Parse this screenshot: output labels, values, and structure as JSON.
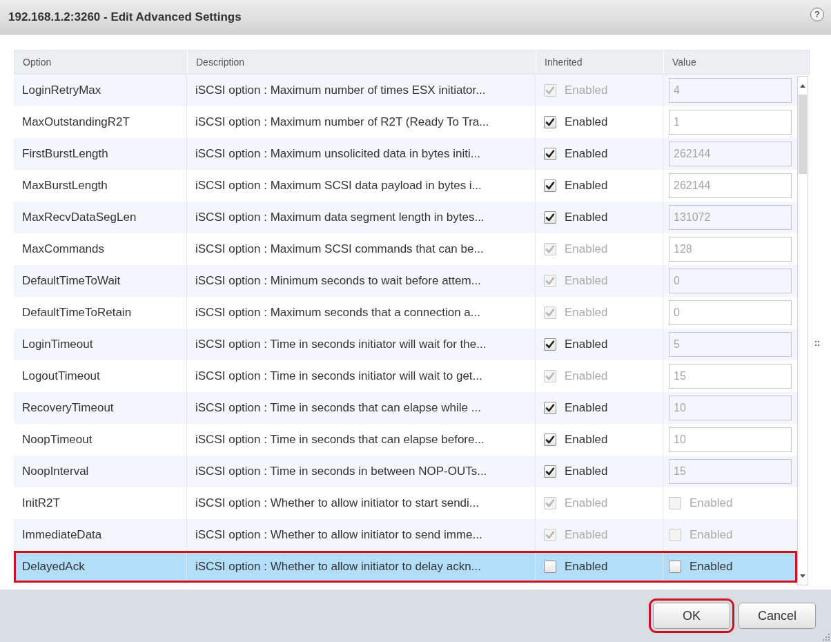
{
  "window": {
    "title": "192.168.1.2:3260 - Edit Advanced Settings",
    "help": "?"
  },
  "table": {
    "columns": [
      "Option",
      "Description",
      "Inherited",
      "Value"
    ],
    "rows": [
      {
        "option": "LoginRetryMax",
        "description": "iSCSI option : Maximum number of times ESX initiator...",
        "inherited": {
          "label": "Enabled",
          "checked": true,
          "disabled": true
        },
        "value": {
          "kind": "text",
          "value": "4",
          "disabled": true
        },
        "selected": false,
        "highlighted": false
      },
      {
        "option": "MaxOutstandingR2T",
        "description": "iSCSI option : Maximum number of R2T (Ready To Tra...",
        "inherited": {
          "label": "Enabled",
          "checked": true,
          "disabled": false
        },
        "value": {
          "kind": "text",
          "value": "1",
          "disabled": true
        },
        "selected": false,
        "highlighted": false
      },
      {
        "option": "FirstBurstLength",
        "description": "iSCSI option : Maximum unsolicited data in bytes initi...",
        "inherited": {
          "label": "Enabled",
          "checked": true,
          "disabled": false
        },
        "value": {
          "kind": "text",
          "value": "262144",
          "disabled": true
        },
        "selected": false,
        "highlighted": false
      },
      {
        "option": "MaxBurstLength",
        "description": "iSCSI option : Maximum SCSI data payload in bytes i...",
        "inherited": {
          "label": "Enabled",
          "checked": true,
          "disabled": false
        },
        "value": {
          "kind": "text",
          "value": "262144",
          "disabled": true
        },
        "selected": false,
        "highlighted": false
      },
      {
        "option": "MaxRecvDataSegLen",
        "description": "iSCSI option : Maximum data segment length in bytes...",
        "inherited": {
          "label": "Enabled",
          "checked": true,
          "disabled": false
        },
        "value": {
          "kind": "text",
          "value": "131072",
          "disabled": true
        },
        "selected": false,
        "highlighted": false
      },
      {
        "option": "MaxCommands",
        "description": "iSCSI option : Maximum SCSI commands that can be...",
        "inherited": {
          "label": "Enabled",
          "checked": true,
          "disabled": true
        },
        "value": {
          "kind": "text",
          "value": "128",
          "disabled": true
        },
        "selected": false,
        "highlighted": false
      },
      {
        "option": "DefaultTimeToWait",
        "description": "iSCSI option : Minimum seconds to wait before attem...",
        "inherited": {
          "label": "Enabled",
          "checked": true,
          "disabled": true
        },
        "value": {
          "kind": "text",
          "value": "0",
          "disabled": true
        },
        "selected": false,
        "highlighted": false
      },
      {
        "option": "DefaultTimeToRetain",
        "description": "iSCSI option : Maximum seconds that a connection a...",
        "inherited": {
          "label": "Enabled",
          "checked": true,
          "disabled": true
        },
        "value": {
          "kind": "text",
          "value": "0",
          "disabled": true
        },
        "selected": false,
        "highlighted": false
      },
      {
        "option": "LoginTimeout",
        "description": "iSCSI option : Time in seconds initiator will wait for the...",
        "inherited": {
          "label": "Enabled",
          "checked": true,
          "disabled": false
        },
        "value": {
          "kind": "text",
          "value": "5",
          "disabled": true
        },
        "selected": false,
        "highlighted": false
      },
      {
        "option": "LogoutTimeout",
        "description": "iSCSI option : Time in seconds initiator will wait to get...",
        "inherited": {
          "label": "Enabled",
          "checked": true,
          "disabled": true
        },
        "value": {
          "kind": "text",
          "value": "15",
          "disabled": true
        },
        "selected": false,
        "highlighted": false
      },
      {
        "option": "RecoveryTimeout",
        "description": "iSCSI option : Time in seconds that can elapse while ...",
        "inherited": {
          "label": "Enabled",
          "checked": true,
          "disabled": false
        },
        "value": {
          "kind": "text",
          "value": "10",
          "disabled": true
        },
        "selected": false,
        "highlighted": false
      },
      {
        "option": "NoopTimeout",
        "description": "iSCSI option : Time in seconds that can elapse before...",
        "inherited": {
          "label": "Enabled",
          "checked": true,
          "disabled": false
        },
        "value": {
          "kind": "text",
          "value": "10",
          "disabled": true
        },
        "selected": false,
        "highlighted": false
      },
      {
        "option": "NoopInterval",
        "description": "iSCSI option : Time in seconds in between NOP-OUTs...",
        "inherited": {
          "label": "Enabled",
          "checked": true,
          "disabled": false
        },
        "value": {
          "kind": "text",
          "value": "15",
          "disabled": true
        },
        "selected": false,
        "highlighted": false
      },
      {
        "option": "InitR2T",
        "description": "iSCSI option : Whether to allow initiator to start sendi...",
        "inherited": {
          "label": "Enabled",
          "checked": true,
          "disabled": true
        },
        "value": {
          "kind": "checkbox",
          "label": "Enabled",
          "checked": false,
          "disabled": true
        },
        "selected": false,
        "highlighted": false
      },
      {
        "option": "ImmediateData",
        "description": "iSCSI option : Whether to allow initiator to send imme...",
        "inherited": {
          "label": "Enabled",
          "checked": true,
          "disabled": true
        },
        "value": {
          "kind": "checkbox",
          "label": "Enabled",
          "checked": false,
          "disabled": true
        },
        "selected": false,
        "highlighted": false
      },
      {
        "option": "DelayedAck",
        "description": "iSCSI option : Whether to allow initiator to delay ackn...",
        "inherited": {
          "label": "Enabled",
          "checked": false,
          "disabled": false
        },
        "value": {
          "kind": "checkbox",
          "label": "Enabled",
          "checked": false,
          "disabled": false
        },
        "selected": true,
        "highlighted": true
      }
    ]
  },
  "buttons": [
    {
      "label": "OK",
      "highlighted": true
    },
    {
      "label": "Cancel",
      "highlighted": false
    }
  ]
}
